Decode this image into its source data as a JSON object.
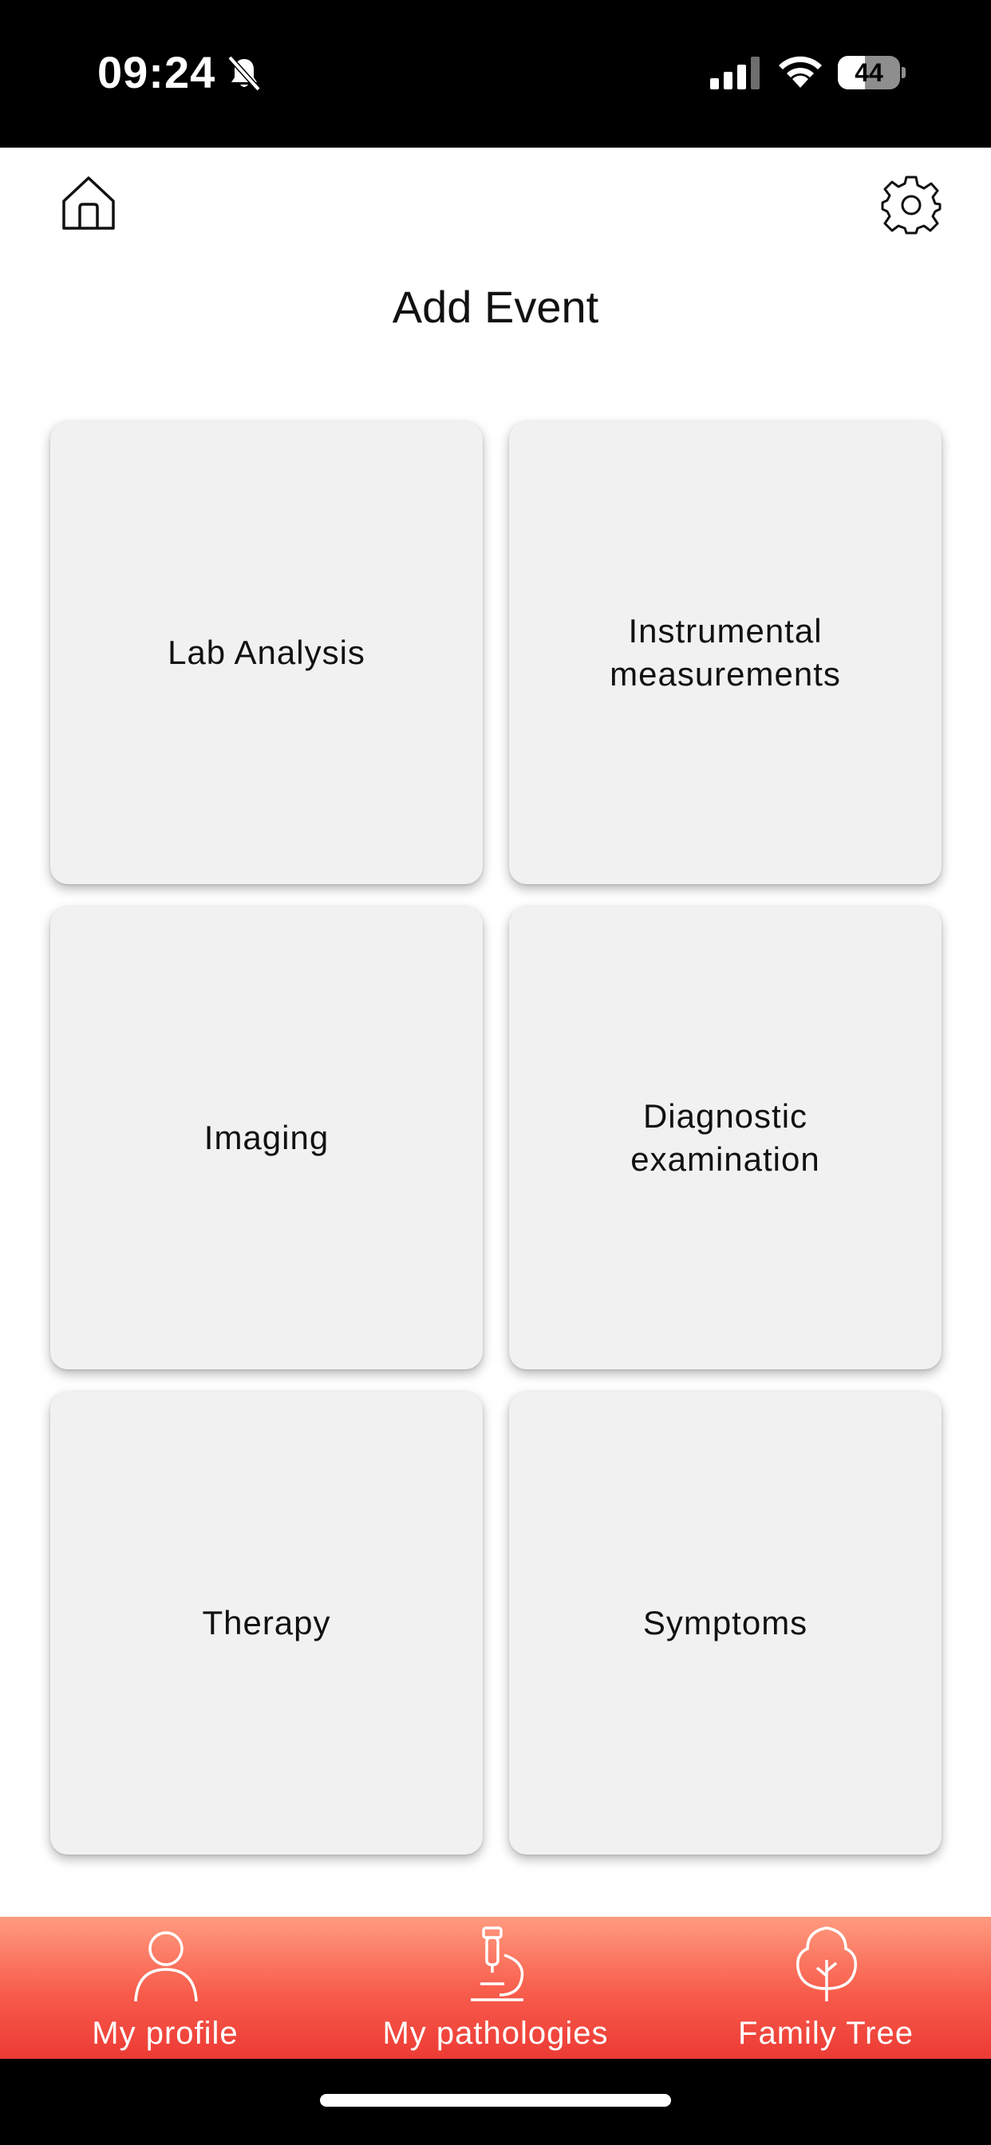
{
  "status_bar": {
    "time": "09:24",
    "battery_level": "44",
    "icons": [
      "bell-slash-icon",
      "cellular-signal-icon",
      "wifi-icon",
      "battery-icon"
    ]
  },
  "header": {
    "home_icon": "home-icon",
    "settings_icon": "gear-icon",
    "title": "Add Event"
  },
  "tiles": [
    {
      "label": "Lab Analysis"
    },
    {
      "label": "Instrumental measurements"
    },
    {
      "label": "Imaging"
    },
    {
      "label": "Diagnostic examination"
    },
    {
      "label": "Therapy"
    },
    {
      "label": "Symptoms"
    }
  ],
  "tab_bar": {
    "items": [
      {
        "label": "My profile",
        "icon": "person-icon"
      },
      {
        "label": "My pathologies",
        "icon": "microscope-icon"
      },
      {
        "label": "Family Tree",
        "icon": "tree-icon"
      }
    ],
    "colors": {
      "top": "#ff9b80",
      "bottom": "#ec3a35"
    }
  },
  "colors": {
    "tile_background": "#f2f1f2",
    "status_bar_background": "#000000"
  }
}
